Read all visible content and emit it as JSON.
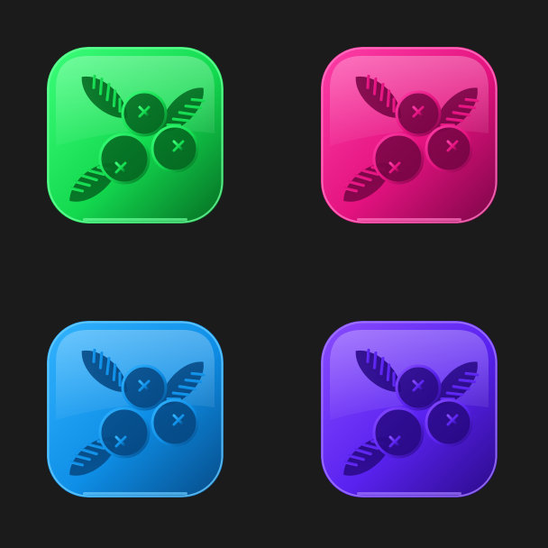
{
  "icons": [
    {
      "id": "green",
      "icon": "berries-icon",
      "colors": {
        "light": "#3dff7a",
        "mid": "#13d94f",
        "dark": "#056b22",
        "edge": "#6dff9c"
      }
    },
    {
      "id": "pink",
      "icon": "berries-icon",
      "colors": {
        "light": "#ff3fa8",
        "mid": "#e3127f",
        "dark": "#7a0546",
        "edge": "#ff78c2"
      }
    },
    {
      "id": "blue",
      "icon": "berries-icon",
      "colors": {
        "light": "#33b4ff",
        "mid": "#0e8ee6",
        "dark": "#064a86",
        "edge": "#69cbff"
      }
    },
    {
      "id": "purple",
      "icon": "berries-icon",
      "colors": {
        "light": "#8a4dff",
        "mid": "#5a22f0",
        "dark": "#2a0a88",
        "edge": "#a27bff"
      }
    }
  ]
}
